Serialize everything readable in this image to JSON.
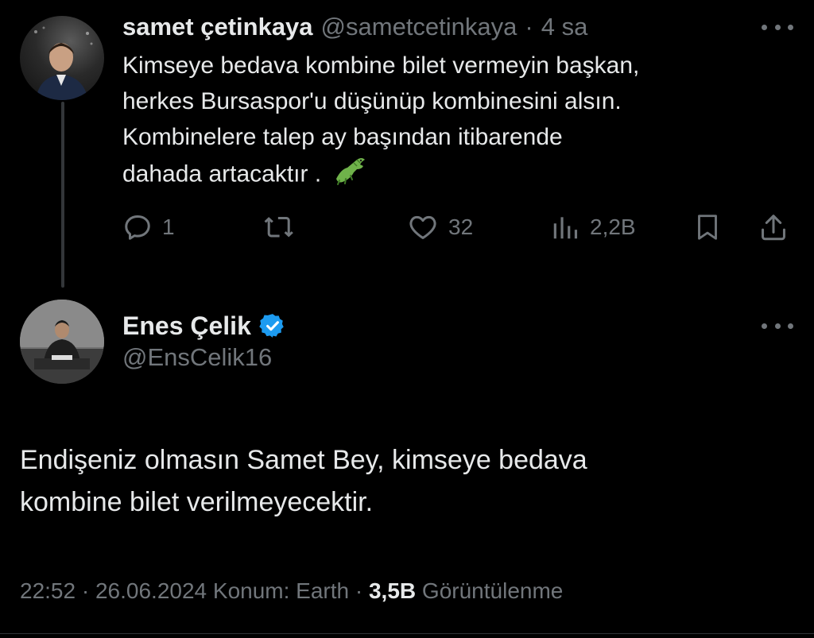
{
  "tweet1": {
    "display_name": "samet çetinkaya",
    "handle": "@sametcetinkaya",
    "separator": "·",
    "time_ago": "4 sa",
    "text_lines": [
      "Kimseye bedava kombine bilet vermeyin başkan,",
      "herkes Bursaspor'u düşünüp kombinesini alsın.",
      "Kombinelere talep ay başından itibarende",
      "dahada artacaktır ."
    ],
    "emoji_icon": "crocodile-icon",
    "actions": {
      "reply_count": "1",
      "retweet_count": "",
      "like_count": "32",
      "views_count": "2,2B"
    }
  },
  "tweet2": {
    "display_name": "Enes Çelik",
    "verified_icon": "verified-badge-icon",
    "handle": "@EnsCelik16",
    "text_lines": [
      "Endişeniz olmasın Samet Bey, kimseye bedava",
      "kombine bilet verilmeyecektir."
    ],
    "meta": {
      "time": "22:52",
      "separator": "·",
      "date": "26.06.2024",
      "location": "Konum: Earth",
      "views_count": "3,5B",
      "views_label": "Görüntülenme"
    }
  },
  "colors": {
    "background": "#000000",
    "primary_text": "#e7e9ea",
    "secondary_text": "#71767b",
    "verified_blue": "#1d9bf0",
    "thread_line": "#333639"
  }
}
